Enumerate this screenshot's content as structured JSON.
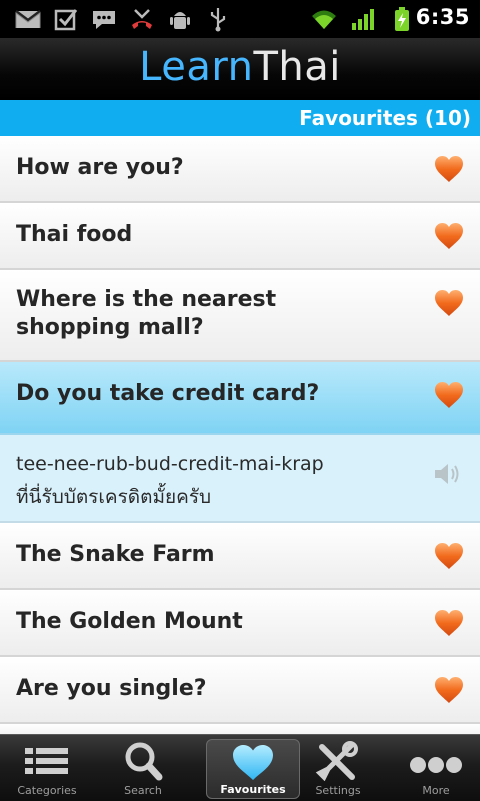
{
  "status_bar": {
    "time": "6:35",
    "icons": [
      "gmail-icon",
      "checkbox-icon",
      "sms-icon",
      "missed-call-icon",
      "android-debug-icon",
      "usb-icon",
      "wifi-icon",
      "signal-icon",
      "battery-charging-icon"
    ]
  },
  "header": {
    "logo_part1": "Learn",
    "logo_part2": "Thai"
  },
  "section": {
    "title": "Favourites (10)"
  },
  "phrases": [
    {
      "title": "How are you?"
    },
    {
      "title": "Thai food"
    },
    {
      "title": "Where is the nearest shopping mall?"
    },
    {
      "title": "Do you take credit card?",
      "selected": true
    },
    {
      "title": "The Snake Farm"
    },
    {
      "title": "The Golden Mount"
    },
    {
      "title": "Are you single?"
    }
  ],
  "expanded": {
    "transliteration": "tee-nee-rub-bud-credit-mai-krap",
    "thai": "ที่นี่รับบัตรเครดิตมั้ยครับ"
  },
  "tabs": [
    {
      "label": "Categories",
      "icon": "list-icon"
    },
    {
      "label": "Search",
      "icon": "search-icon"
    },
    {
      "label": "Favourites",
      "icon": "heart-icon",
      "active": true
    },
    {
      "label": "Settings",
      "icon": "tools-icon"
    },
    {
      "label": "More",
      "icon": "more-icon"
    }
  ],
  "colors": {
    "accent_blue": "#10aef0",
    "selected_row": "#a3def7",
    "expanded_bg": "#d9f1fb",
    "heart": "#f26b1d"
  }
}
